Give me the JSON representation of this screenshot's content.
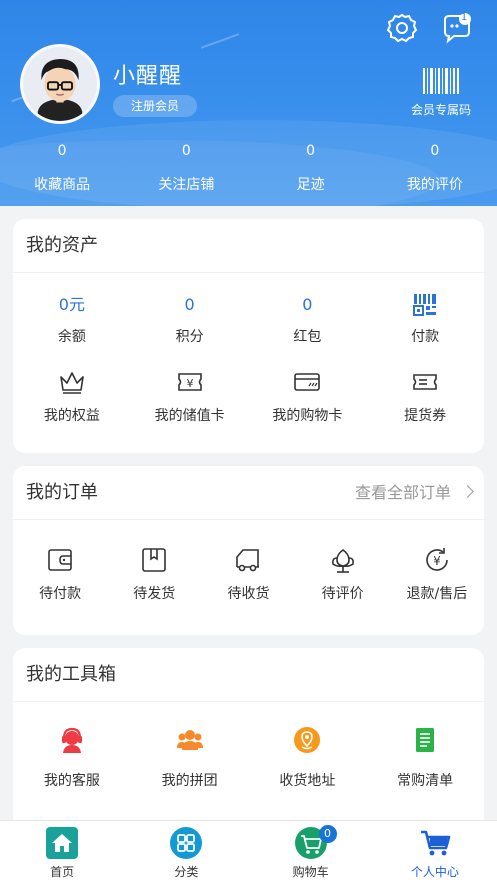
{
  "profile": {
    "username": "小醒醒",
    "member_level": "注册会员",
    "barcode_label": "会员专属码",
    "message_badge": "1"
  },
  "stats": [
    {
      "value": "0",
      "label": "收藏商品"
    },
    {
      "value": "0",
      "label": "关注店铺"
    },
    {
      "value": "0",
      "label": "足迹"
    },
    {
      "value": "0",
      "label": "我的评价"
    }
  ],
  "assets": {
    "title": "我的资产",
    "items": [
      {
        "value": "0元",
        "label": "余额"
      },
      {
        "value": "0",
        "label": "积分"
      },
      {
        "value": "0",
        "label": "红包"
      },
      {
        "icon": "qr-pay-icon",
        "label": "付款"
      },
      {
        "icon": "crown-icon",
        "label": "我的权益"
      },
      {
        "icon": "yen-card-icon",
        "label": "我的储值卡"
      },
      {
        "icon": "shopping-card-icon",
        "label": "我的购物卡"
      },
      {
        "icon": "coupon-icon",
        "label": "提货券"
      }
    ]
  },
  "orders": {
    "title": "我的订单",
    "view_all": "查看全部订单",
    "items": [
      {
        "icon": "wallet-icon",
        "label": "待付款"
      },
      {
        "icon": "package-icon",
        "label": "待发货"
      },
      {
        "icon": "truck-icon",
        "label": "待收货"
      },
      {
        "icon": "flower-icon",
        "label": "待评价"
      },
      {
        "icon": "refund-icon",
        "label": "退款/售后"
      }
    ]
  },
  "toolbox": {
    "title": "我的工具箱",
    "items": [
      {
        "icon": "customer-service-icon",
        "label": "我的客服",
        "color": "#ef3b43"
      },
      {
        "icon": "group-buy-icon",
        "label": "我的拼团",
        "color": "#f7892d"
      },
      {
        "icon": "location-icon",
        "label": "收货地址",
        "color": "#f59a1c"
      },
      {
        "icon": "list-icon",
        "label": "常购清单",
        "color": "#2bb34a"
      }
    ]
  },
  "tabbar": {
    "items": [
      {
        "label": "首页",
        "icon": "home-icon"
      },
      {
        "label": "分类",
        "icon": "category-icon"
      },
      {
        "label": "购物车",
        "icon": "cart-icon",
        "badge": "0"
      },
      {
        "label": "个人中心",
        "icon": "profile-cart-icon",
        "active": true
      }
    ]
  },
  "colors": {
    "header_blue": "#2f86e8",
    "accent_blue": "#2b73d8",
    "active_tab": "#1f5fd6"
  }
}
